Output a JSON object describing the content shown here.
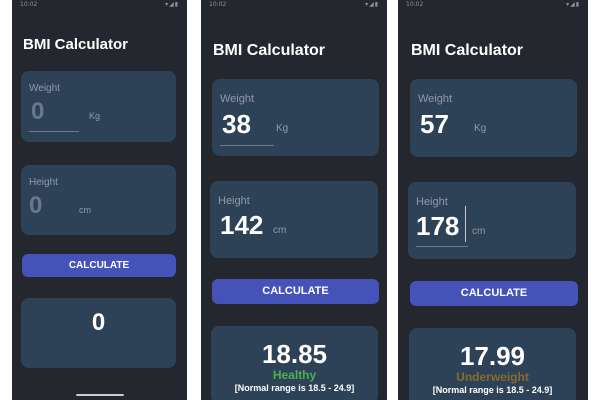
{
  "status_bar": {
    "time": "10:02",
    "icons": "▾◢▮"
  },
  "screens": [
    {
      "title": "BMI Calculator",
      "weight": {
        "label": "Weight",
        "value": "0",
        "unit": "Kg"
      },
      "height": {
        "label": "Height",
        "value": "0",
        "unit": "cm"
      },
      "button": "CALCULATE",
      "result": {
        "bmi": "0",
        "category": "",
        "range": ""
      }
    },
    {
      "title": "BMI Calculator",
      "weight": {
        "label": "Weight",
        "value": "38",
        "unit": "Kg"
      },
      "height": {
        "label": "Height",
        "value": "142",
        "unit": "cm"
      },
      "button": "CALCULATE",
      "result": {
        "bmi": "18.85",
        "category": "Healthy",
        "category_color": "#4caf50",
        "range": "[Normal range is 18.5 - 24.9]"
      }
    },
    {
      "title": "BMI Calculator",
      "weight": {
        "label": "Weight",
        "value": "57",
        "unit": "Kg"
      },
      "height": {
        "label": "Height",
        "value": "178",
        "unit": "cm"
      },
      "button": "CALCULATE",
      "result": {
        "bmi": "17.99",
        "category": "Underweight",
        "category_color": "#8a6a2c",
        "range": "[Normal range is 18.5 - 24.9]"
      }
    }
  ],
  "colors": {
    "background": "#24272d",
    "card": "#2e4257",
    "button": "#4553b8",
    "text": "#ffffff",
    "muted": "#8f9aa8"
  }
}
